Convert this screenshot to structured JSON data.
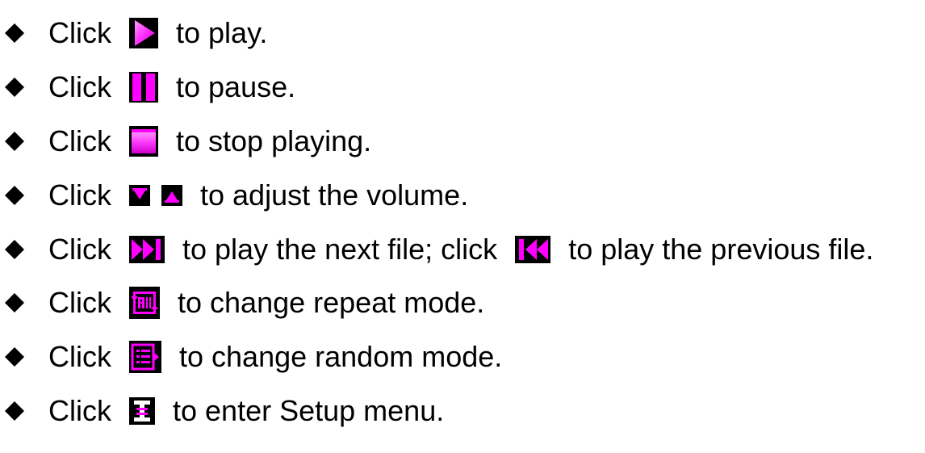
{
  "accent_color": "#ff00ff",
  "bullet_icon": "diamond-bullet-icon",
  "items": [
    {
      "click": "Click",
      "icons": [
        "play-icon"
      ],
      "text": "to play."
    },
    {
      "click": "Click",
      "icons": [
        "pause-icon"
      ],
      "text": "to pause."
    },
    {
      "click": "Click",
      "icons": [
        "stop-icon"
      ],
      "text": "to stop playing."
    },
    {
      "click": "Click",
      "icons": [
        "volume-down-icon",
        "volume-up-icon"
      ],
      "text": "to adjust the volume."
    },
    {
      "click": "Click",
      "icons": [
        "next-track-icon"
      ],
      "text": "to play the next file; click",
      "icons2": [
        "previous-track-icon"
      ],
      "text2": "to play the previous file."
    },
    {
      "click": "Click",
      "icons": [
        "repeat-all-icon"
      ],
      "text": "to change repeat mode."
    },
    {
      "click": "Click",
      "icons": [
        "random-mode-icon"
      ],
      "text": "to change random mode."
    },
    {
      "click": "Click",
      "icons": [
        "setup-menu-icon"
      ],
      "text": "to enter Setup menu."
    }
  ]
}
